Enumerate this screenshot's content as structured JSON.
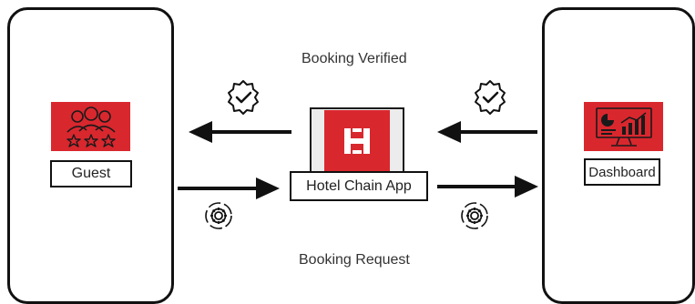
{
  "guest": {
    "label": "Guest",
    "icon": "guest-group-rating-icon"
  },
  "dashboard": {
    "label": "Dashboard",
    "icon": "analytics-monitor-icon"
  },
  "app": {
    "label": "Hotel Chain App",
    "logo_letter": "H",
    "icon": "hotel-logo-icon"
  },
  "captions": {
    "top": "Booking Verified",
    "bottom": "Booking Request"
  },
  "colors": {
    "accent": "#d9272e",
    "ink": "#111111",
    "app_bg": "#ececec"
  }
}
